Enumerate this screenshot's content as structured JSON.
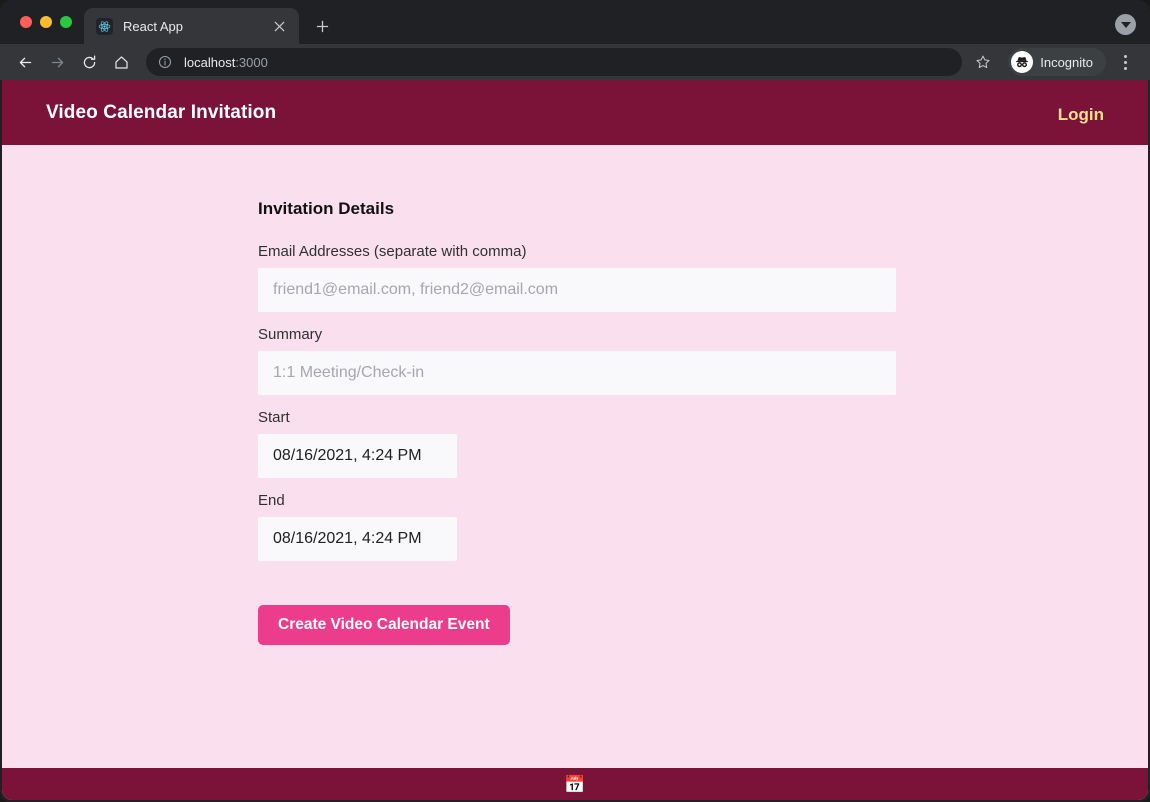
{
  "browser": {
    "tab": {
      "title": "React App",
      "favicon_icon": "react-logo-icon",
      "close_icon": "close-icon"
    },
    "new_tab_label": "+",
    "tab_search_icon": "chevron-down-icon",
    "nav": {
      "back_icon": "arrow-left-icon",
      "forward_icon": "arrow-right-icon",
      "reload_icon": "reload-icon",
      "home_icon": "home-icon"
    },
    "omnibox": {
      "info_icon": "info-circle-icon",
      "host": "localhost",
      "port": ":3000"
    },
    "bookmark_icon": "star-icon",
    "profile": {
      "label": "Incognito",
      "avatar_icon": "incognito-icon"
    },
    "menu_icon": "kebab-menu-icon",
    "window_controls": [
      "close",
      "minimize",
      "maximize"
    ]
  },
  "page": {
    "header": {
      "title": "Video Calendar Invitation",
      "login_label": "Login",
      "bg_color": "#7b1338",
      "login_color": "#f7e08c"
    },
    "main": {
      "bg_color": "#fae0ee",
      "section_title": "Invitation Details",
      "fields": [
        {
          "label": "Email Addresses (separate with comma)",
          "placeholder": "friend1@email.com, friend2@email.com",
          "value": "",
          "type": "text"
        },
        {
          "label": "Summary",
          "placeholder": "1:1 Meeting/Check-in",
          "value": "",
          "type": "text"
        },
        {
          "label": "Start",
          "placeholder": "",
          "value": "08/16/2021, 4:24 PM",
          "type": "datetime"
        },
        {
          "label": "End",
          "placeholder": "",
          "value": "08/16/2021, 4:24 PM",
          "type": "datetime"
        }
      ],
      "submit_label": "Create Video Calendar Event",
      "submit_color": "#ec3d8c"
    },
    "footer": {
      "icon": "calendar-emoji",
      "glyph": "📅",
      "bg_color": "#7b1338"
    }
  }
}
